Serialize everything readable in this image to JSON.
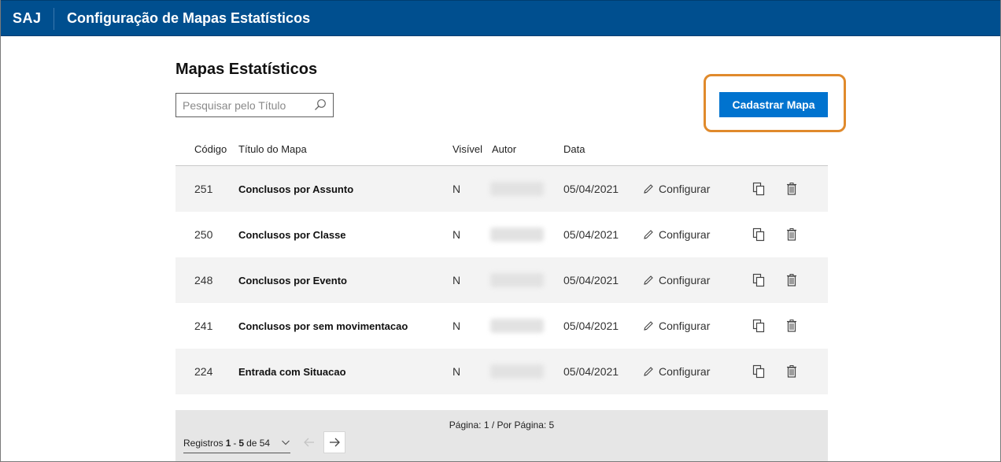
{
  "header": {
    "brand": "SAJ",
    "title": "Configuração de Mapas Estatísticos"
  },
  "page": {
    "title": "Mapas Estatísticos"
  },
  "search": {
    "placeholder": "Pesquisar pelo Título",
    "value": ""
  },
  "actions": {
    "create_label": "Cadastrar Mapa",
    "highlight_color": "#e08a2c",
    "primary_color": "#0073cf"
  },
  "table": {
    "columns": {
      "code": "Código",
      "title": "Título do Mapa",
      "visible": "Visível",
      "author": "Autor",
      "date": "Data"
    },
    "configure_label": "Configurar",
    "rows": [
      {
        "code": "251",
        "title": "Conclusos por Assunto",
        "visible": "N",
        "date": "05/04/2021"
      },
      {
        "code": "250",
        "title": "Conclusos por Classe",
        "visible": "N",
        "date": "05/04/2021"
      },
      {
        "code": "248",
        "title": "Conclusos por Evento",
        "visible": "N",
        "date": "05/04/2021"
      },
      {
        "code": "241",
        "title": "Conclusos por sem movimentacao",
        "visible": "N",
        "date": "05/04/2021"
      },
      {
        "code": "224",
        "title": "Entrada com Situacao",
        "visible": "N",
        "date": "05/04/2021"
      }
    ]
  },
  "pagination": {
    "page_info": "Página: 1 / Por Página: 5",
    "records_prefix": "Registros",
    "range_start": "1",
    "range_sep": "-",
    "range_end": "5",
    "range_of": "de 54"
  },
  "icons": [
    "search-icon",
    "pencil-icon",
    "copy-icon",
    "trash-icon",
    "chevron-down-icon",
    "arrow-left-icon",
    "arrow-right-icon"
  ]
}
